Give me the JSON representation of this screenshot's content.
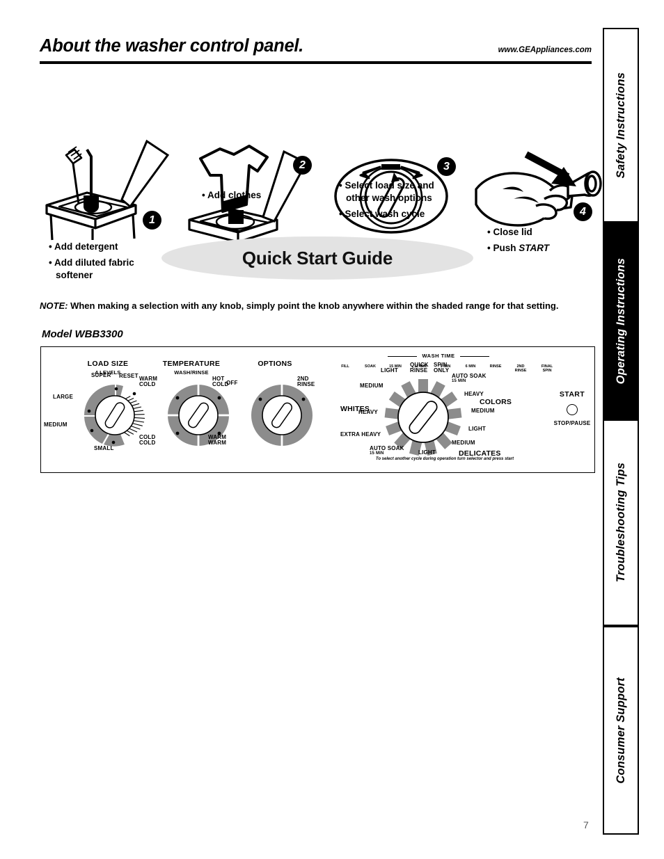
{
  "header": {
    "title": "About the washer control panel.",
    "url": "www.GEAppliances.com"
  },
  "side_tabs": [
    {
      "label": "Safety Instructions",
      "active": false
    },
    {
      "label": "Operating Instructions",
      "active": true
    },
    {
      "label": "Troubleshooting Tips",
      "active": false
    },
    {
      "label": "Consumer Support",
      "active": false
    }
  ],
  "quick_start": {
    "banner": "Quick Start Guide",
    "steps": [
      {
        "number": "1",
        "bullets": [
          "Add detergent",
          "Add diluted fabric softener"
        ],
        "icon": "washer-detergent-icon"
      },
      {
        "number": "2",
        "bullets": [
          "Add clothes"
        ],
        "icon": "washer-clothes-icon"
      },
      {
        "number": "3",
        "bullets": [
          "Select load size and other wash options",
          "Select wash cycle"
        ],
        "icon": "knob-turn-icon"
      },
      {
        "number": "4",
        "bullets": [
          "Close lid",
          "Push START"
        ],
        "icon": "hand-push-icon"
      }
    ],
    "push_start_emphasis": "START"
  },
  "note": {
    "label": "NOTE:",
    "text": "When making a selection with any knob, simply point the knob anywhere within the shaded range for that setting."
  },
  "model_label": "Model WBB3300",
  "control_panel": {
    "load_size": {
      "title": "LOAD SIZE",
      "subtitle": "4 LEVELS",
      "settings": [
        "SUPER",
        "RESET",
        "LARGE",
        "MEDIUM",
        "SMALL"
      ]
    },
    "temperature": {
      "title": "TEMPERATURE",
      "subtitle": "WASH/RINSE",
      "settings": [
        "WARM COLD",
        "HOT COLD",
        "COLD COLD",
        "WARM WARM"
      ]
    },
    "options": {
      "title": "OPTIONS",
      "settings": [
        "OFF",
        "2ND RINSE"
      ]
    },
    "wash_time": {
      "header": "WASH TIME",
      "ticks": [
        "FILL",
        "SOAK",
        "15 MIN",
        "12 MIN",
        "9 MIN",
        "6 MIN",
        "RINSE",
        "2ND RINSE",
        "FINAL SPIN"
      ]
    },
    "cycle_selector": {
      "group_labels": [
        "WHITES",
        "COLORS",
        "DELICATES"
      ],
      "settings": [
        "LIGHT",
        "QUICK RINSE",
        "SPIN ONLY",
        "AUTO SOAK 15 MIN",
        "HEAVY",
        "MEDIUM",
        "LIGHT",
        "MEDIUM",
        "LIGHT",
        "AUTO SOAK 15 MIN",
        "EXTRA HEAVY",
        "HEAVY",
        "MEDIUM"
      ],
      "footnote": "To select another cycle during operation turn selector and press start"
    },
    "start": {
      "label": "START",
      "secondary_label": "STOP/PAUSE"
    }
  },
  "page_number": "7",
  "colors": {
    "dial_shading": "#8c8c8c",
    "banner_fill": "#e3e3e3",
    "ink": "#000000"
  }
}
